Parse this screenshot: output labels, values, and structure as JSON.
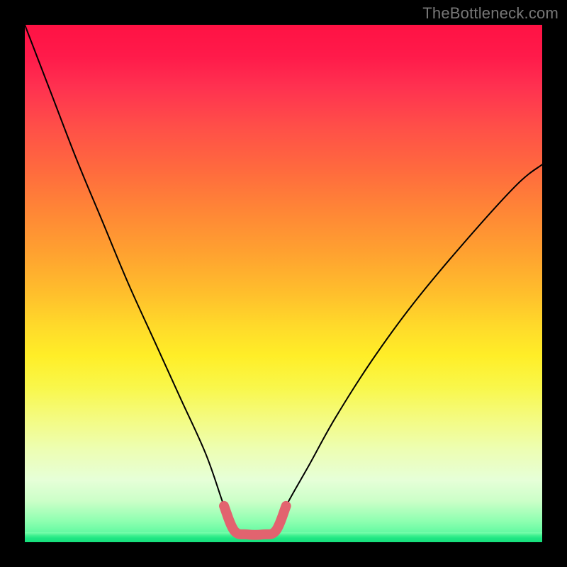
{
  "watermark": "TheBottleneck.com",
  "chart_data": {
    "type": "line",
    "title": "",
    "xlabel": "",
    "ylabel": "",
    "xlim": [
      0,
      100
    ],
    "ylim": [
      0,
      100
    ],
    "grid": false,
    "legend": false,
    "series": [
      {
        "name": "bottleneck-curve",
        "x": [
          0,
          5,
          10,
          15,
          20,
          25,
          30,
          35,
          38.5,
          40.5,
          43,
          46,
          48.5,
          50.5,
          55,
          60,
          67,
          75,
          85,
          95,
          100
        ],
        "values": [
          100,
          87,
          74,
          62,
          50,
          39,
          28,
          17,
          7,
          2.2,
          1.5,
          1.5,
          2.2,
          7,
          15,
          24,
          35,
          46,
          58,
          69,
          73
        ]
      },
      {
        "name": "highlight-segment",
        "x": [
          38.5,
          40.5,
          43,
          46,
          48.5,
          50.5
        ],
        "values": [
          7,
          2.2,
          1.5,
          1.5,
          2.2,
          7
        ]
      }
    ],
    "colors": {
      "curve": "#000000",
      "highlight": "#e2636f",
      "gradient_top": "#ff1244",
      "gradient_bottom": "#16e07c"
    }
  }
}
